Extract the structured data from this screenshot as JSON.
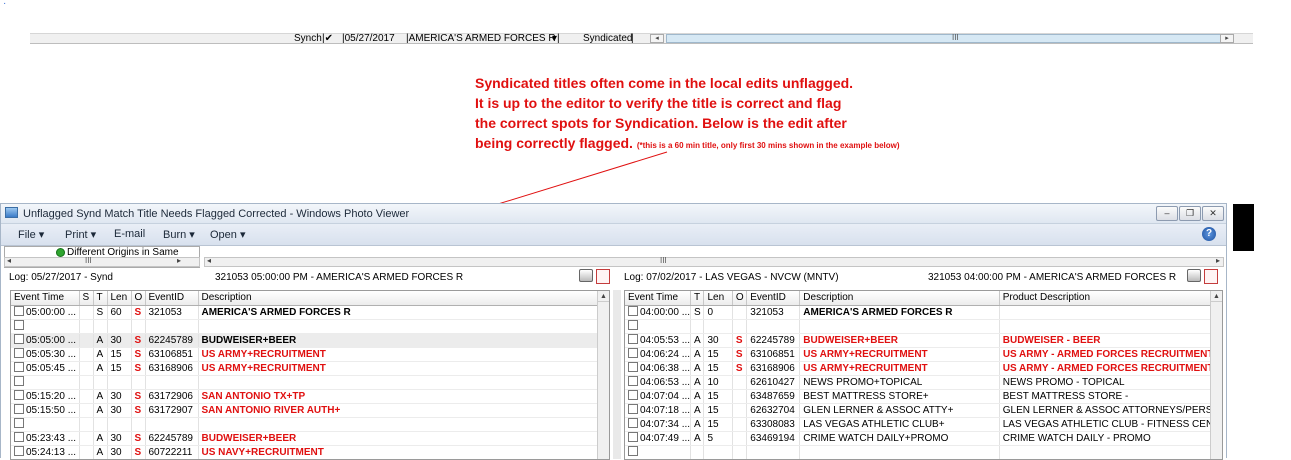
{
  "corner_mark": "·",
  "top_strip": {
    "synch_label": "Synch",
    "date_value": "05/27/2017",
    "title_value": "AMERICA'S ARMED FORCES R",
    "syndicated_label": "Syndicated",
    "scroll_grip": "III"
  },
  "annotation": {
    "line1": "Syndicated titles often come in the local edits unflagged.",
    "line2": "It is up to the editor to verify the title is correct and flag",
    "line3": "the correct spots for Syndication.   Below is the edit after",
    "line4": "being correctly flagged.",
    "small_note": "(*this is a 60 min title, only first 30 mins shown in the example below)",
    "arrow_color": "#e01010"
  },
  "window": {
    "title": "Unflagged Synd Match Title Needs Flagged Corrected - Windows Photo Viewer",
    "menu": [
      "File",
      "Print",
      "E-mail",
      "Burn",
      "Open"
    ],
    "help_icon": "help-icon",
    "tree_node": "Different Origins in Same",
    "hscroll_grip": "III",
    "left": {
      "log_label": "Log: 05/27/2017 - Synd",
      "event_header": "321053 05:00:00 PM - AMERICA'S ARMED FORCES R",
      "columns": [
        "Event Time",
        "S",
        "T",
        "Len",
        "O",
        "EventID",
        "Description"
      ],
      "rows": [
        {
          "time": "05:00:00 ...",
          "s": "",
          "t": "S",
          "len": "60",
          "o": "S",
          "id": "321053",
          "desc": "AMERICA'S ARMED FORCES R",
          "style": "bold"
        },
        {
          "time": "",
          "s": "",
          "t": "",
          "len": "",
          "o": "",
          "id": "",
          "desc": "",
          "style": ""
        },
        {
          "time": "05:05:00 ...",
          "s": "",
          "t": "A",
          "len": "30",
          "o": "S",
          "id": "62245789",
          "desc": "BUDWEISER+BEER",
          "style": "bold",
          "hl": true
        },
        {
          "time": "05:05:30 ...",
          "s": "",
          "t": "A",
          "len": "15",
          "o": "S",
          "id": "63106851",
          "desc": "US ARMY+RECRUITMENT",
          "style": "red"
        },
        {
          "time": "05:05:45 ...",
          "s": "",
          "t": "A",
          "len": "15",
          "o": "S",
          "id": "63168906",
          "desc": "US ARMY+RECRUITMENT",
          "style": "red"
        },
        {
          "time": "",
          "s": "",
          "t": "",
          "len": "",
          "o": "",
          "id": "",
          "desc": "",
          "style": ""
        },
        {
          "time": "05:15:20 ...",
          "s": "",
          "t": "A",
          "len": "30",
          "o": "S",
          "id": "63172906",
          "desc": "SAN ANTONIO TX+TP",
          "style": "red"
        },
        {
          "time": "05:15:50 ...",
          "s": "",
          "t": "A",
          "len": "30",
          "o": "S",
          "id": "63172907",
          "desc": "SAN ANTONIO RIVER AUTH+",
          "style": "red"
        },
        {
          "time": "",
          "s": "",
          "t": "",
          "len": "",
          "o": "",
          "id": "",
          "desc": "",
          "style": ""
        },
        {
          "time": "05:23:43 ...",
          "s": "",
          "t": "A",
          "len": "30",
          "o": "S",
          "id": "62245789",
          "desc": "BUDWEISER+BEER",
          "style": "red"
        },
        {
          "time": "05:24:13 ...",
          "s": "",
          "t": "A",
          "len": "30",
          "o": "S",
          "id": "60722211",
          "desc": "US NAVY+RECRUITMENT",
          "style": "red"
        }
      ]
    },
    "right": {
      "log_label": "Log:  07/02/2017 - LAS VEGAS - NVCW (MNTV)",
      "event_header": "321053 04:00:00 PM - AMERICA'S ARMED FORCES R",
      "columns": [
        "Event Time",
        "T",
        "Len",
        "O",
        "EventID",
        "Description",
        "Product Description"
      ],
      "rows": [
        {
          "time": "04:00:00 ...",
          "t": "S",
          "len": "0",
          "o": "",
          "id": "321053",
          "desc": "AMERICA'S ARMED FORCES R",
          "prod": "",
          "style": "bold"
        },
        {
          "time": "",
          "t": "",
          "len": "",
          "o": "",
          "id": "",
          "desc": "",
          "prod": "",
          "style": ""
        },
        {
          "time": "04:05:53 ...",
          "t": "A",
          "len": "30",
          "o": "S",
          "id": "62245789",
          "desc": "BUDWEISER+BEER",
          "prod": "BUDWEISER - BEER",
          "style": "red"
        },
        {
          "time": "04:06:24 ...",
          "t": "A",
          "len": "15",
          "o": "S",
          "id": "63106851",
          "desc": "US ARMY+RECRUITMENT",
          "prod": "US ARMY - ARMED FORCES RECRUITMENT",
          "style": "red"
        },
        {
          "time": "04:06:38 ...",
          "t": "A",
          "len": "15",
          "o": "S",
          "id": "63168906",
          "desc": "US ARMY+RECRUITMENT",
          "prod": "US ARMY - ARMED FORCES RECRUITMENT",
          "style": "red"
        },
        {
          "time": "04:06:53 ...",
          "t": "A",
          "len": "10",
          "o": "",
          "id": "62610427",
          "desc": "NEWS PROMO+TOPICAL",
          "prod": "NEWS PROMO - TOPICAL",
          "style": ""
        },
        {
          "time": "04:07:04 ...",
          "t": "A",
          "len": "15",
          "o": "",
          "id": "63487659",
          "desc": "BEST MATTRESS STORE+",
          "prod": "BEST MATTRESS STORE -",
          "style": ""
        },
        {
          "time": "04:07:18 ...",
          "t": "A",
          "len": "15",
          "o": "",
          "id": "62632704",
          "desc": "GLEN LERNER & ASSOC ATTY+",
          "prod": "GLEN LERNER & ASSOC ATTORNEYS/PERSO",
          "style": ""
        },
        {
          "time": "04:07:34 ...",
          "t": "A",
          "len": "15",
          "o": "",
          "id": "63308083",
          "desc": "LAS VEGAS ATHLETIC CLUB+",
          "prod": "LAS VEGAS ATHLETIC CLUB - FITNESS CENT.",
          "style": ""
        },
        {
          "time": "04:07:49 ...",
          "t": "A",
          "len": "5",
          "o": "",
          "id": "63469194",
          "desc": "CRIME WATCH DAILY+PROMO",
          "prod": "CRIME WATCH DAILY - PROMO",
          "style": ""
        },
        {
          "time": "",
          "t": "",
          "len": "",
          "o": "",
          "id": "",
          "desc": "",
          "prod": "",
          "style": ""
        }
      ]
    }
  }
}
